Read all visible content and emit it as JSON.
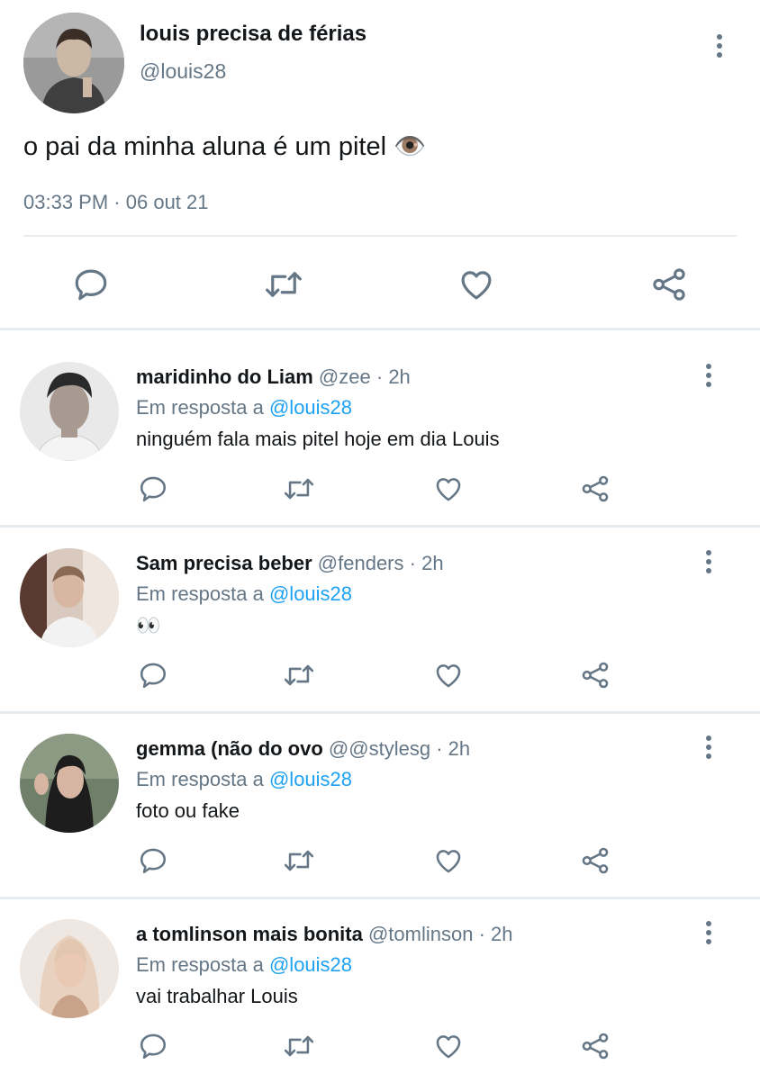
{
  "main_tweet": {
    "name": "louis precisa de férias",
    "handle": "@louis28",
    "text": "o pai da minha aluna é um pitel 👁️",
    "time": "03:33 PM",
    "separator": "·",
    "date": "06 out 21"
  },
  "reply_prefix": "Em resposta a",
  "replies": [
    {
      "name": "maridinho do Liam",
      "handle": "@zee",
      "time": "2h",
      "mention": "@louis28",
      "text": "ninguém fala mais pitel hoje em dia Louis"
    },
    {
      "name": "Sam precisa beber",
      "handle": "@fenders",
      "time": "2h",
      "mention": "@louis28",
      "text": "👀"
    },
    {
      "name": "gemma (não do ovo",
      "handle": "@@stylesg",
      "time": "2h",
      "mention": "@louis28",
      "text": "foto ou fake"
    },
    {
      "name": "a tomlinson mais bonita",
      "handle": "@tomlinson",
      "time": "2h",
      "mention": "@louis28",
      "text": "vai trabalhar Louis"
    }
  ],
  "icons": {
    "reply": "reply-icon",
    "retweet": "retweet-icon",
    "like": "heart-icon",
    "share": "share-icon",
    "more": "more-icon"
  },
  "colors": {
    "text": "#14171a",
    "secondary": "#657786",
    "link": "#1da1f2",
    "divider": "#e6ecf0"
  }
}
